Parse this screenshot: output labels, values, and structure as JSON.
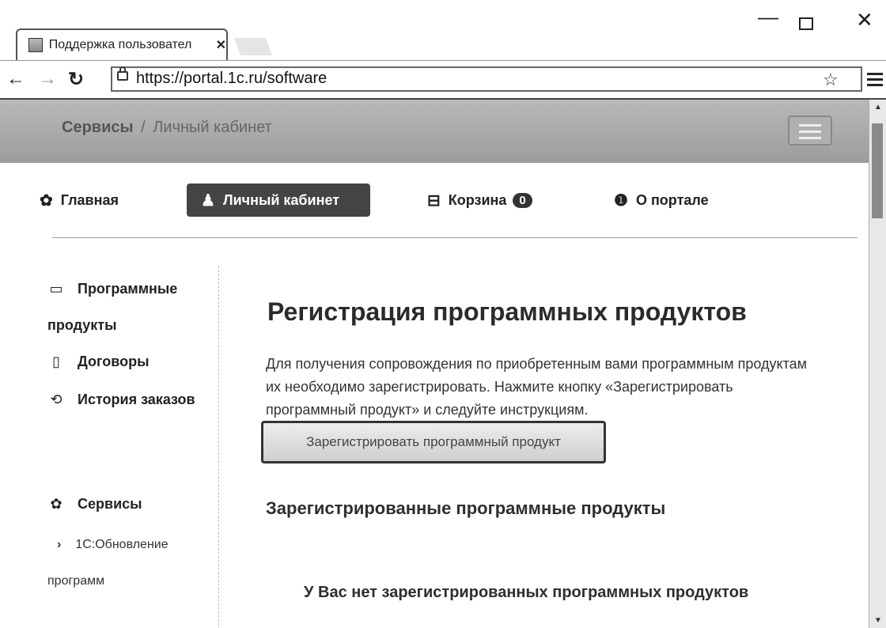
{
  "browser": {
    "tab_title": "Поддержка пользовател",
    "url_scheme": "https://",
    "url_host": "portal.1c.ru",
    "url_path": "/software"
  },
  "banner": {
    "services": "Сервисы",
    "separator": "/",
    "current": "Личный кабинет"
  },
  "mainnav": {
    "home": "Главная",
    "cabinet": "Личный кабинет",
    "cart": "Корзина",
    "cart_count": "0",
    "about": "О портале"
  },
  "sidebar": {
    "products": "Программные продукты",
    "contracts": "Договоры",
    "history": "История заказов",
    "services": "Сервисы",
    "update": "1С:Обновление программ"
  },
  "content": {
    "title": "Регистрация программных продуктов",
    "description": "Для получения сопровождения по приобретенным вами программным продуктам их необходимо зарегистрировать. Нажмите кнопку «Зарегистрировать программный продукт» и следуйте инструкциям.",
    "register_button": "Зарегистрировать программный продукт",
    "registered_heading": "Зарегистрированные программные продукты",
    "empty_message": "У Вас нет зарегистрированных программных продуктов"
  },
  "icons": {
    "home": "gear-flower-icon",
    "cabinet": "user-icon",
    "cart": "cart-icon",
    "about": "info-icon",
    "products": "laptop-icon",
    "contracts": "file-icon",
    "history": "history-icon",
    "services": "gear-flower-icon"
  }
}
